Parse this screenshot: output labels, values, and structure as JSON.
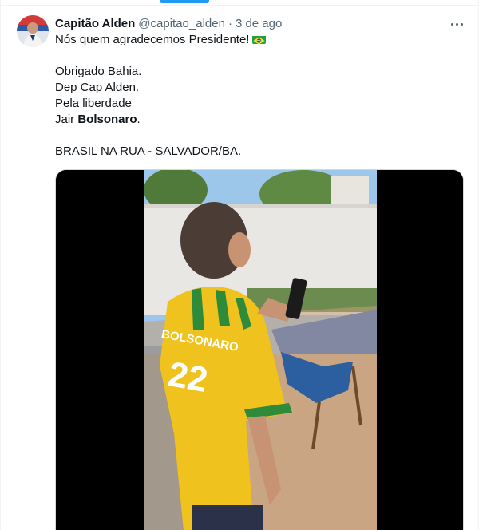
{
  "tweet": {
    "author": {
      "display_name": "Capitão Alden",
      "handle": "@capitao_alden",
      "separator": "·",
      "time": "3 de ago"
    },
    "text": {
      "line1": "Nós quem agradecemos Presidente!",
      "line1_emoji": "brazil-flag",
      "line2": "Obrigado Bahia.",
      "line3": "Dep Cap Alden.",
      "line4": "Pela liberdade",
      "line5_prefix": "Jair ",
      "line5_bold": "Bolsonaro",
      "line5_suffix": ".",
      "line6": "BRASIL NA RUA - SALVADOR/BA."
    },
    "media": {
      "jersey_name": "BOLSONARO",
      "jersey_number": "22"
    },
    "more_icon": "more-horizontal-icon"
  },
  "colors": {
    "accent": "#1d9bf0",
    "secondary_text": "#536471",
    "primary_text": "#0f1419",
    "jersey_yellow": "#f2c51f",
    "jersey_green": "#2e8b3a"
  }
}
